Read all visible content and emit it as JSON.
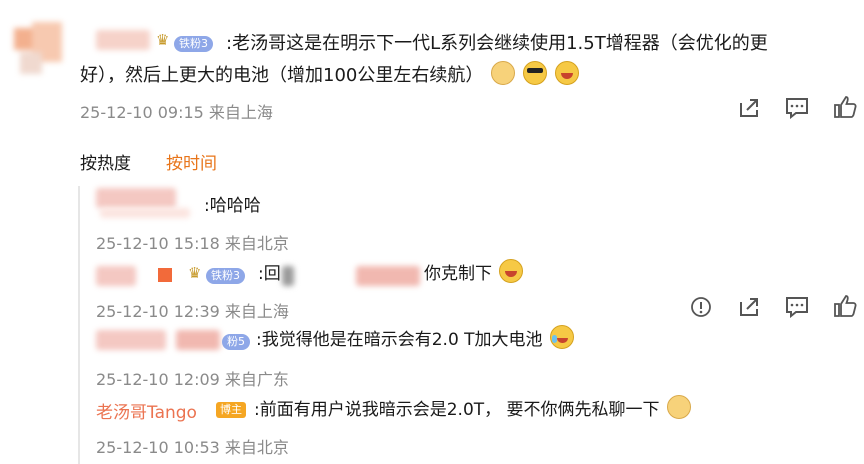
{
  "main_comment": {
    "badge": "铁粉3",
    "text_line1": ":老汤哥这是在明示下一代L系列会继续使用1.5T增程器（会优化的更",
    "text_line2": "好），然后上更大的电池（增加100公里左右续航）",
    "meta": "25-12-10 09:15 来自上海",
    "icons": [
      "share-icon",
      "comment-icon",
      "like-icon"
    ]
  },
  "sort_tabs": {
    "hot": "按热度",
    "time": "按时间",
    "active": "time"
  },
  "replies": [
    {
      "text": ":哈哈哈",
      "meta": "25-12-10 15:18 来自北京"
    },
    {
      "badge": "铁粉3",
      "prefix": ":回",
      "suffix": "你克制下",
      "meta": "25-12-10 12:39 来自上海",
      "icons": [
        "info-icon",
        "share-icon",
        "comment-icon",
        "like-icon"
      ]
    },
    {
      "badge": "粉5",
      "text": ":我觉得他是在暗示会有2.0 T加大电池",
      "meta": "25-12-10 12:09 来自广东"
    },
    {
      "author": "老汤哥Tango",
      "host_badge": "博主",
      "text": ":前面有用户说我暗示会是2.0T，  要不你俩先私聊一下",
      "meta": "25-12-10 10:53 来自北京"
    }
  ],
  "colors": {
    "accent": "#e8751a",
    "author": "#eb7350",
    "meta": "#8a8a8a"
  }
}
